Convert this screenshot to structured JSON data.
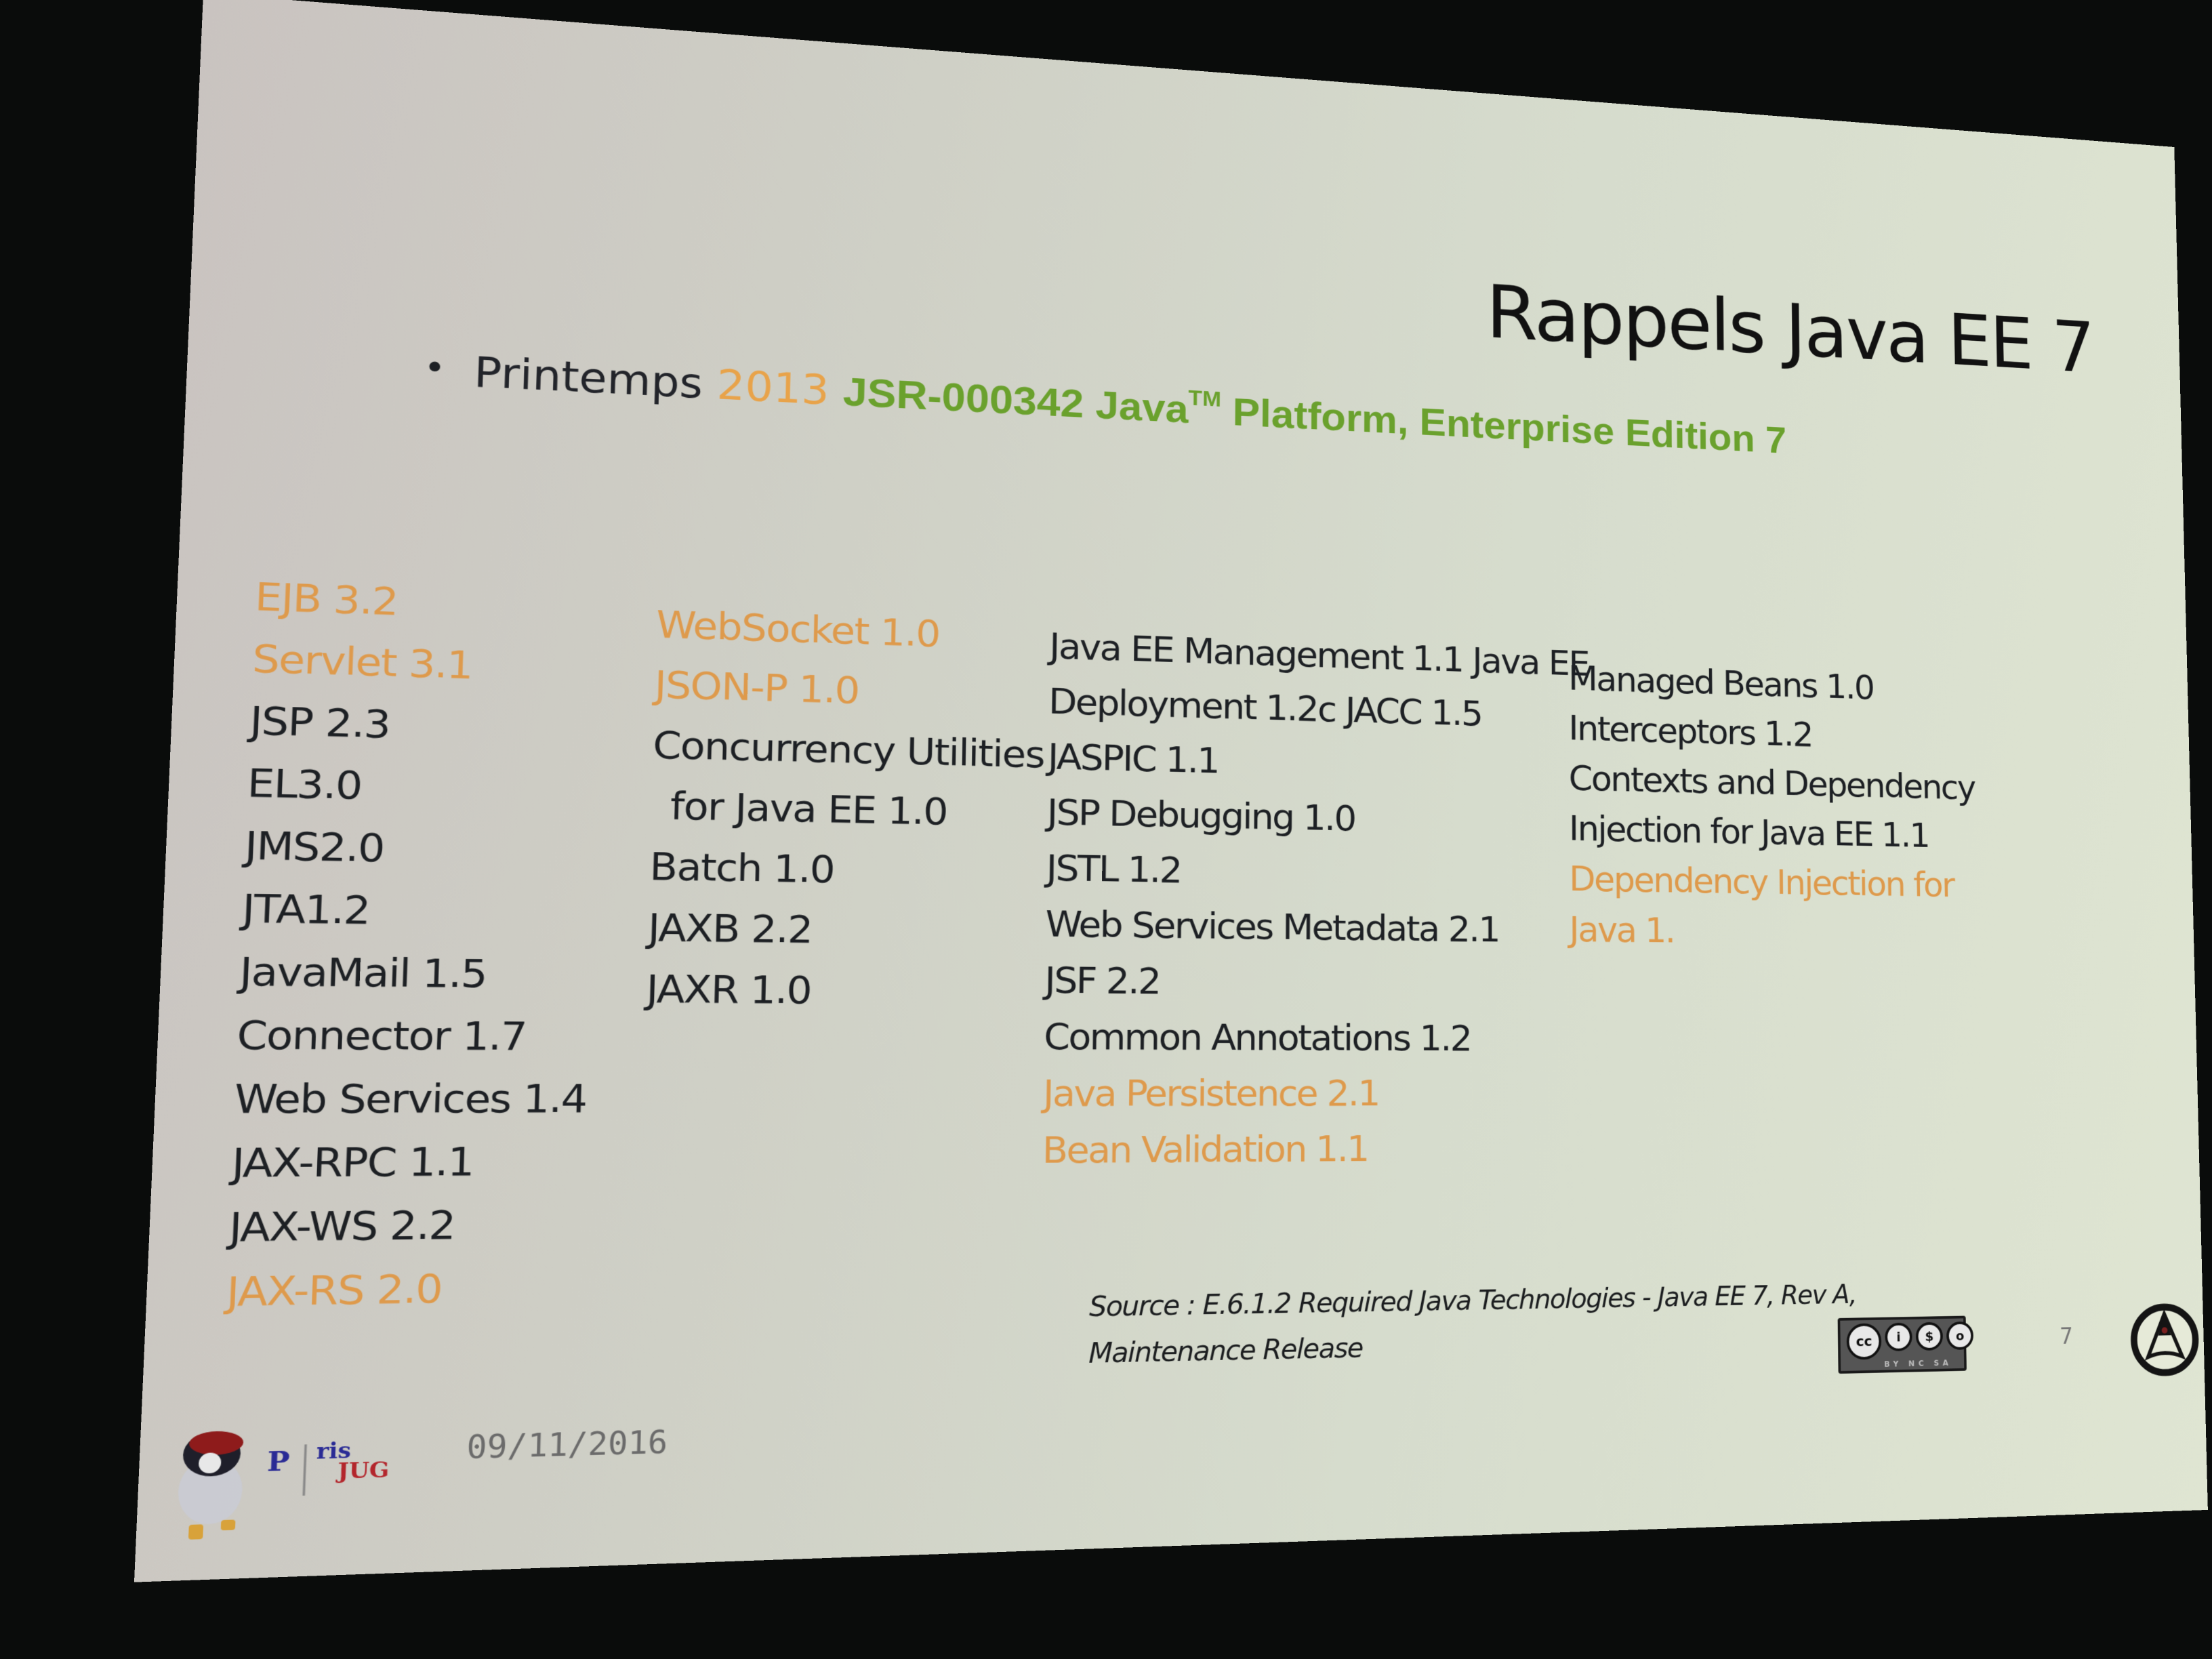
{
  "slide": {
    "title": "Rappels Java EE 7",
    "subtitle": {
      "bullet": "•",
      "lead": "Printemps",
      "year": "2013",
      "jsr": "JSR-000342 Java",
      "tm": "TM",
      "rest": " Platform, Enterprise Edition 7"
    },
    "columns": [
      {
        "items": [
          {
            "text": "EJB 3.2",
            "highlight": true
          },
          {
            "text": "Servlet 3.1",
            "highlight": true
          },
          {
            "text": "JSP 2.3",
            "highlight": false
          },
          {
            "text": "EL3.0",
            "highlight": false
          },
          {
            "text": "JMS2.0",
            "highlight": false
          },
          {
            "text": "JTA1.2",
            "highlight": false
          },
          {
            "text": "JavaMail 1.5",
            "highlight": false
          },
          {
            "text": "Connector 1.7",
            "highlight": false
          },
          {
            "text": "Web Services 1.4",
            "highlight": false
          },
          {
            "text": "JAX-RPC 1.1",
            "highlight": false
          },
          {
            "text": "JAX-WS 2.2",
            "highlight": false
          },
          {
            "text": "JAX-RS 2.0",
            "highlight": true
          }
        ]
      },
      {
        "items": [
          {
            "text": "WebSocket 1.0",
            "highlight": true
          },
          {
            "text": "JSON-P 1.0",
            "highlight": true
          },
          {
            "text": "Concurrency Utilities",
            "highlight": false
          },
          {
            "text": "for Java EE 1.0",
            "highlight": false,
            "indent": true
          },
          {
            "text": "Batch 1.0",
            "highlight": false
          },
          {
            "text": "JAXB 2.2",
            "highlight": false
          },
          {
            "text": "JAXR 1.0",
            "highlight": false
          }
        ]
      },
      {
        "items": [
          {
            "text": "Java EE Management 1.1 Java EE",
            "highlight": false
          },
          {
            "text": "Deployment 1.2c JACC 1.5",
            "highlight": false
          },
          {
            "text": "JASPIC 1.1",
            "highlight": false
          },
          {
            "text": "JSP Debugging 1.0",
            "highlight": false
          },
          {
            "text": "JSTL 1.2",
            "highlight": false
          },
          {
            "text": "Web Services Metadata 2.1",
            "highlight": false
          },
          {
            "text": "JSF 2.2",
            "highlight": false
          },
          {
            "text": "Common Annotations 1.2",
            "highlight": false
          },
          {
            "text": "Java Persistence 2.1",
            "highlight": true
          },
          {
            "text": "Bean Validation 1.1",
            "highlight": true
          }
        ]
      },
      {
        "items": [
          {
            "text": "Managed Beans 1.0",
            "highlight": false
          },
          {
            "text": "Interceptors 1.2",
            "highlight": false
          },
          {
            "text": "Contexts and Dependency",
            "highlight": false
          },
          {
            "text": "Injection for Java EE 1.1",
            "highlight": false
          },
          {
            "text": "Dependency Injection for",
            "highlight": true
          },
          {
            "text": "Java 1.",
            "highlight": true
          }
        ]
      }
    ],
    "source": {
      "line1": "Source : E.6.1.2 Required Java Technologies - Java EE 7, Rev A,",
      "line2": "Maintenance Release"
    },
    "footer": {
      "logo_icon": "parisjug-duke-logo",
      "logo_text_p": "P",
      "logo_text_ris": "ris",
      "logo_text_jug": "JUG",
      "date": "09/11/2016",
      "license_icon": "creative-commons-by-nc-sa-icon",
      "license_labels": [
        "cc",
        "i",
        "$",
        "o"
      ],
      "license_caption": "BY NC SA",
      "page_number": "7",
      "brand_icon": "circular-a-logo-icon"
    },
    "colors": {
      "highlight": "#de9a4c",
      "year": "#e8a34a",
      "jsr": "#6aa12d",
      "text": "#1d2024"
    }
  }
}
